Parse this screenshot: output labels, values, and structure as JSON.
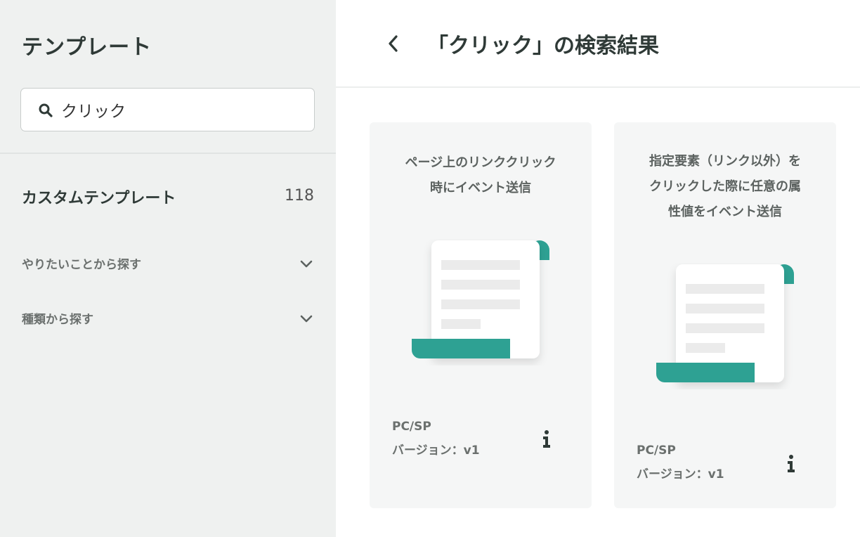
{
  "sidebar": {
    "title": "テンプレート",
    "search": {
      "value": "クリック",
      "placeholder": ""
    },
    "custom_templates": {
      "label": "カスタムテンプレート",
      "count": "118"
    },
    "accordions": [
      {
        "label": "やりたいことから探す"
      },
      {
        "label": "種類から探す"
      }
    ]
  },
  "main": {
    "title": "「クリック」の検索結果",
    "cards": [
      {
        "title_lines": [
          "ページ上のリンククリック",
          "時にイベント送信"
        ],
        "platform": "PC/SP",
        "version": "バージョン：v1"
      },
      {
        "title_lines": [
          "指定要素（リンク以外）を",
          "クリックした際に任意の属",
          "性値をイベント送信"
        ],
        "platform": "PC/SP",
        "version": "バージョン：v1"
      }
    ]
  },
  "colors": {
    "accent": "#2ea193",
    "sidebar_bg": "#eff1f0",
    "card_bg": "#f5f6f6"
  },
  "icons": [
    "search-icon",
    "chevron-down-icon",
    "back-icon",
    "info-icon",
    "document-illustration"
  ]
}
